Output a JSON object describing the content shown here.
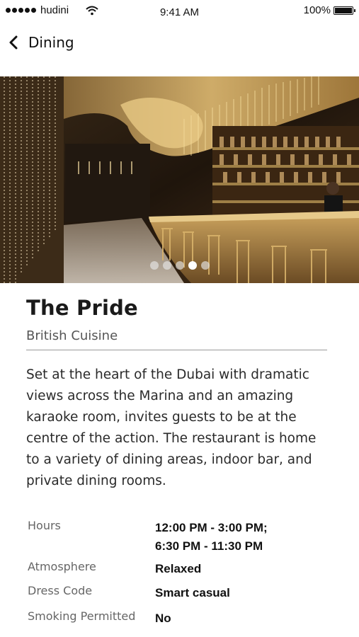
{
  "status_bar": {
    "carrier": "hudini",
    "time": "9:41 AM",
    "battery": "100%"
  },
  "nav": {
    "back_label": "Dining"
  },
  "hero": {
    "carousel_count": 5,
    "carousel_active_index": 3
  },
  "restaurant": {
    "name": "The Pride",
    "cuisine": "British Cuisine",
    "description": "Set at the heart of the Dubai with dramatic views across the Marina and an amazing karaoke room, invites guests to be at the centre of the action. The restaurant is home to a variety of dining areas, indoor bar, and private dining rooms."
  },
  "details": [
    {
      "label": "Hours",
      "value": "12:00 PM - 3:00 PM;\n6:30 PM - 11:30 PM"
    },
    {
      "label": "Atmosphere",
      "value": "Relaxed"
    },
    {
      "label": "Dress Code",
      "value": "Smart casual"
    },
    {
      "label": "Smoking Permitted",
      "value": "No"
    }
  ]
}
